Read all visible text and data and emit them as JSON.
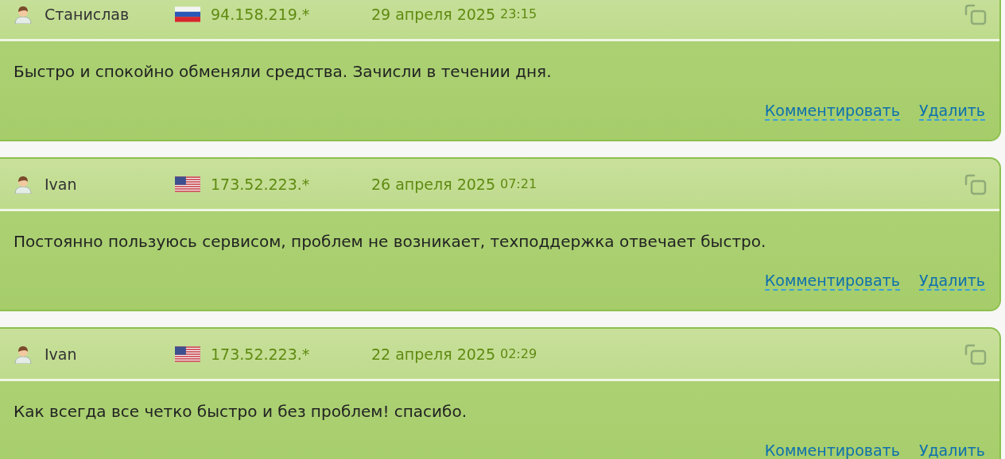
{
  "reviews": [
    {
      "author": "Станислав",
      "kind": "ru",
      "ip": "94.158.219.*",
      "date": "29 апреля 2025",
      "time": "23:15",
      "text": "Быстро и спокойно обменяли средства. Зачисли в течении дня.",
      "actions": [
        "Комментировать",
        "Удалить"
      ]
    },
    {
      "author": "Ivan",
      "kind": "us",
      "ip": "173.52.223.*",
      "date": "26 апреля 2025",
      "time": "07:21",
      "text": "Постоянно пользуюсь сервисом, проблем не возникает, техподдержка отвечает быстро.",
      "actions": [
        "Комментировать",
        "Удалить"
      ]
    },
    {
      "author": "Ivan",
      "kind": "us",
      "ip": "173.52.223.*",
      "date": "22 апреля 2025",
      "time": "02:29",
      "text": "Как всегда все четко быстро и без проблем! спасибо.",
      "actions": [
        "Комментировать",
        "Удалить"
      ]
    }
  ]
}
